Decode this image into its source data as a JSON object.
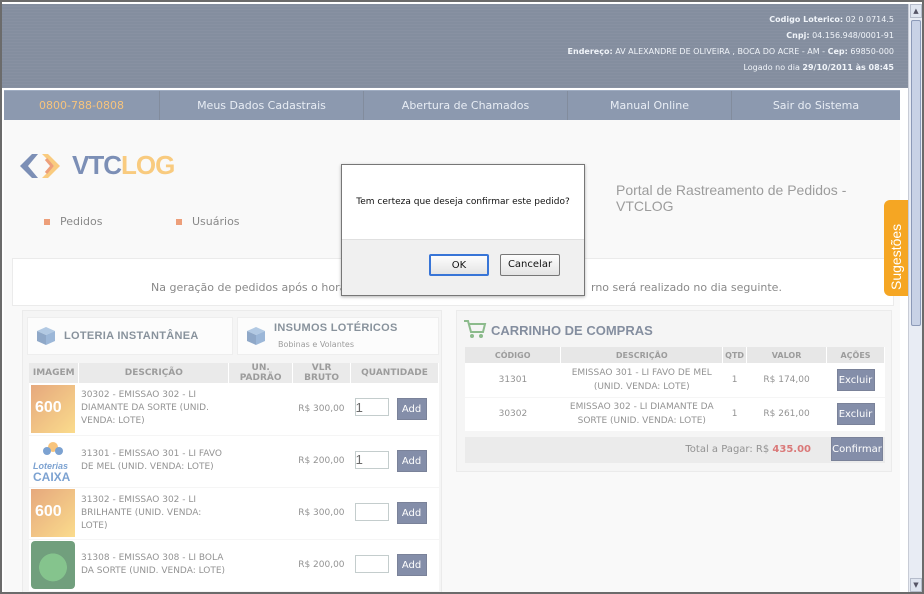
{
  "header": {
    "codigo_label": "Codigo Loterico:",
    "codigo_value": "02 0 0714.5",
    "cnpj_label": "Cnpj:",
    "cnpj_value": "04.156.948/0001-91",
    "endereco_label": "Endereço:",
    "endereco_value": "AV ALEXANDRE DE OLIVEIRA , BOCA DO ACRE - AM - ",
    "cep_label": "Cep:",
    "cep_value": "69850-000",
    "logado_prefix": "Logado no dia",
    "logado_date": "29/10/2011 às 08:45"
  },
  "nav": {
    "phone": "0800-788-0808",
    "items": [
      "Meus Dados Cadastrais",
      "Abertura de Chamados",
      "Manual Online",
      "Sair do Sistema"
    ]
  },
  "brand": {
    "logo_part1": "VTC",
    "logo_part2": "LOG",
    "portal_title": "Portal de Rastreamento de Pedidos - VTCLOG",
    "accent": "#f5a623",
    "primary": "#2c3d5b"
  },
  "tabs": [
    "Pedidos",
    "Usuários"
  ],
  "notice": {
    "left": "Na geração de pedidos após o horário",
    "right": "rno será realizado no dia seguinte."
  },
  "categories": [
    {
      "title": "LOTERIA INSTANTÂNEA",
      "subtitle": ""
    },
    {
      "title": "INSUMOS LOTÉRICOS",
      "subtitle": "Bobinas e Volantes"
    }
  ],
  "products": {
    "headers": [
      "IMAGEM",
      "DESCRIÇÃO",
      "UN. PADRÃO",
      "VLR BRUTO",
      "QUANTIDADE"
    ],
    "rows": [
      {
        "thumb": "t600",
        "desc": "30302 - EMISSAO 302 - LI DIAMANTE DA SORTE (UNID. VENDA: LOTE)",
        "price": "R$ 300,00",
        "qty": "1",
        "add": "Add"
      },
      {
        "thumb": "caixa",
        "desc": "31301 - EMISSAO 301 - LI FAVO DE MEL (UNID. VENDA: LOTE)",
        "price": "R$ 200,00",
        "qty": "1",
        "add": "Add"
      },
      {
        "thumb": "t600",
        "desc": "31302 - EMISSAO 302 - LI BRILHANTE (UNID. VENDA: LOTE)",
        "price": "R$ 300,00",
        "qty": "",
        "add": "Add"
      },
      {
        "thumb": "green",
        "desc": "31308 - EMISSAO 308 - LI BOLA DA SORTE (UNID. VENDA: LOTE)",
        "price": "R$ 200,00",
        "qty": "",
        "add": "Add"
      }
    ]
  },
  "cart": {
    "title": "CARRINHO DE COMPRAS",
    "headers": [
      "CÓDIGO",
      "DESCRIÇÃO",
      "QTD",
      "VALOR",
      "AÇÕES"
    ],
    "rows": [
      {
        "code": "31301",
        "desc": "EMISSAO 301 - LI FAVO DE MEL (UNID. VENDA: LOTE)",
        "qty": "1",
        "value": "R$ 174,00",
        "action": "Excluir"
      },
      {
        "code": "30302",
        "desc": "EMISSAO 302 - LI DIAMANTE DA SORTE (UNID. VENDA: LOTE)",
        "qty": "1",
        "value": "R$ 261,00",
        "action": "Excluir"
      }
    ],
    "total_label": "Total a Pagar: R$",
    "total_value": "435.00",
    "confirm": "Confirmar"
  },
  "dialog": {
    "message": "Tem certeza que deseja confirmar este pedido?",
    "ok": "OK",
    "cancel": "Cancelar"
  },
  "side_tab": "Sugestões"
}
